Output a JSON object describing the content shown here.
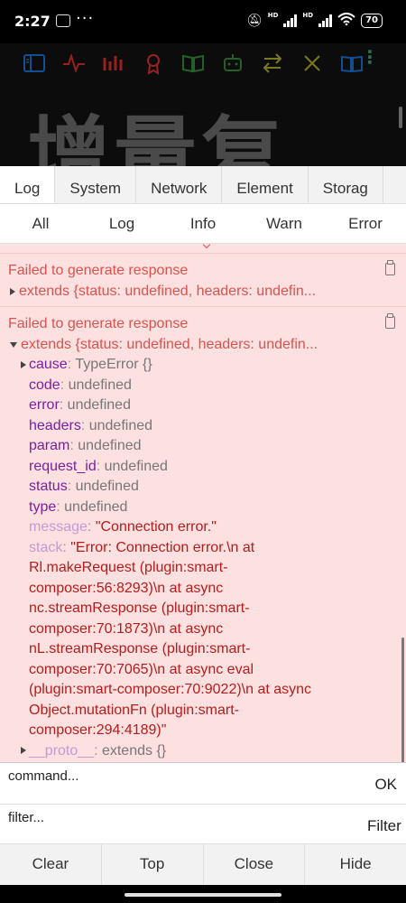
{
  "status_bar": {
    "time": "2:27",
    "more": "···",
    "battery": "70",
    "hd": "HD"
  },
  "app": {
    "heading": "增量复",
    "more": "⋮",
    "toolbar_icons": [
      "sidebar-icon",
      "activity-icon",
      "bar-chart-icon",
      "award-icon",
      "book-open-icon",
      "bot-icon",
      "arrows-swap-icon",
      "close-x-icon",
      "book-icon"
    ]
  },
  "console": {
    "tabs": [
      "Log",
      "System",
      "Network",
      "Element",
      "Storag"
    ],
    "filters": [
      "All",
      "Log",
      "Info",
      "Warn",
      "Error"
    ],
    "entries": [
      {
        "message": "Failed to generate response",
        "summary": "extends {status: undefined, headers: undefin..."
      },
      {
        "message": "Failed to generate response",
        "summary": "extends {status: undefined, headers: undefin...",
        "props": {
          "cause": {
            "key": "cause",
            "value": "TypeError {}"
          },
          "code": {
            "key": "code",
            "value": "undefined"
          },
          "error": {
            "key": "error",
            "value": "undefined"
          },
          "headers": {
            "key": "headers",
            "value": "undefined"
          },
          "param": {
            "key": "param",
            "value": "undefined"
          },
          "request_id": {
            "key": "request_id",
            "value": "undefined"
          },
          "status": {
            "key": "status",
            "value": "undefined"
          },
          "type": {
            "key": "type",
            "value": "undefined"
          },
          "message": {
            "key": "message",
            "value": "\"Connection error.\""
          },
          "stack": {
            "key": "stack",
            "value": "\"Error: Connection error.\\n at",
            "lines": [
              "Rl.makeRequest (plugin:smart-",
              "composer:56:8293)\\n at async",
              "nc.streamResponse (plugin:smart-",
              "composer:70:1873)\\n at async",
              "nL.streamResponse (plugin:smart-",
              "composer:70:7065)\\n at async eval",
              "(plugin:smart-composer:70:9022)\\n at async",
              "Object.mutationFn (plugin:smart-",
              "composer:294:4189)\""
            ]
          },
          "proto": {
            "key": "__proto__",
            "value": "extends {}"
          }
        }
      }
    ],
    "command_placeholder": "command...",
    "ok_label": "OK",
    "filter_placeholder": "filter...",
    "filter_label": "Filter",
    "bottom_buttons": [
      "Clear",
      "Top",
      "Close",
      "Hide"
    ]
  },
  "colors": {
    "log_bg": "#fde0e0",
    "error_text": "#d9534f",
    "prop_key": "#7b1fa2",
    "string_value": "#b71c1c",
    "app_icon_red": "#c62828",
    "app_icon_green": "#2e7d32",
    "app_icon_blue": "#1565c0",
    "app_icon_yellow": "#9e9d24"
  }
}
